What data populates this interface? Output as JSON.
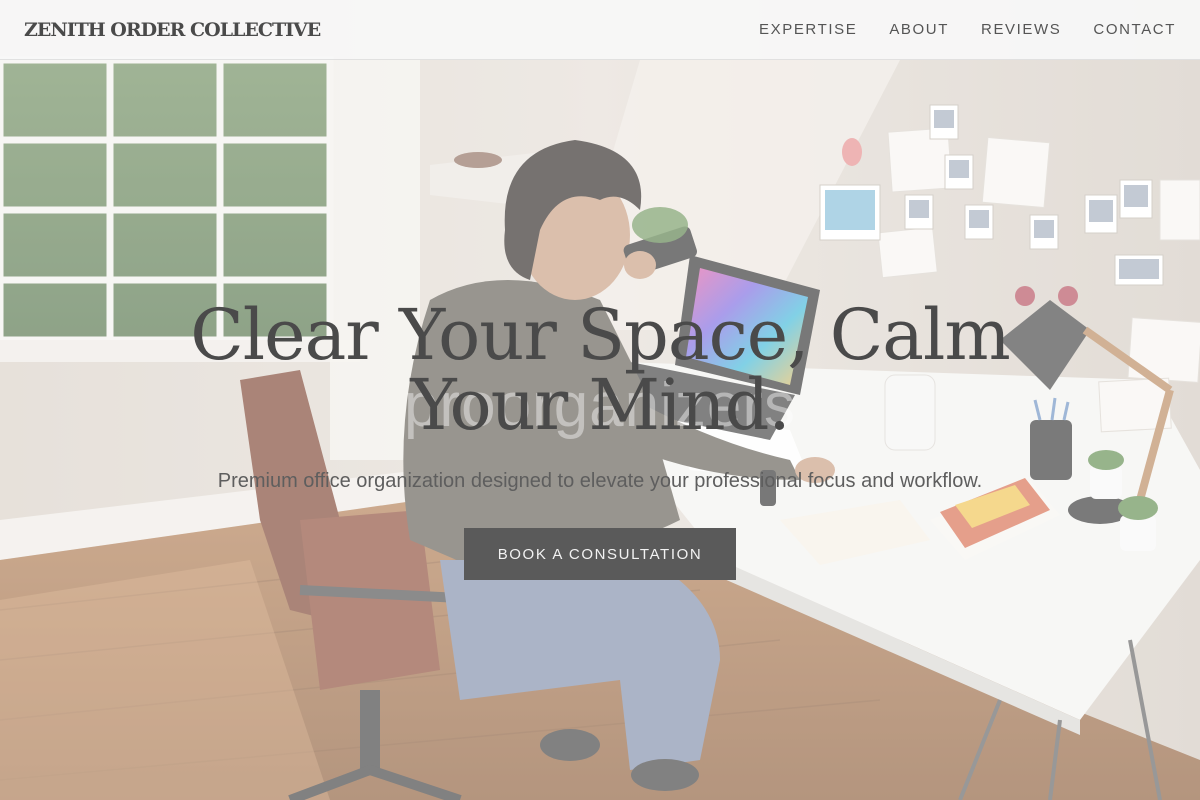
{
  "header": {
    "brand": "ZENITH ORDER COLLECTIVE",
    "nav": [
      {
        "label": "EXPERTISE"
      },
      {
        "label": "ABOUT"
      },
      {
        "label": "REVIEWS"
      },
      {
        "label": "CONTACT"
      }
    ]
  },
  "hero": {
    "title_line1": "Clear Your Space, Calm",
    "title_line2": "Your Mind.",
    "subtitle": "Premium office organization designed to elevate your professional focus and workflow.",
    "cta_label": "BOOK A CONSULTATION",
    "ghost_watermark": "proorganizers"
  },
  "colors": {
    "header_bg": "#f8f8f7",
    "text_dark": "#4a4a4a",
    "button_bg": "#5a5a5a",
    "button_text": "#f2f2f2",
    "floor": "#9a6a45"
  },
  "background": {
    "image_subject": "person-at-desk-home-office-photo"
  }
}
